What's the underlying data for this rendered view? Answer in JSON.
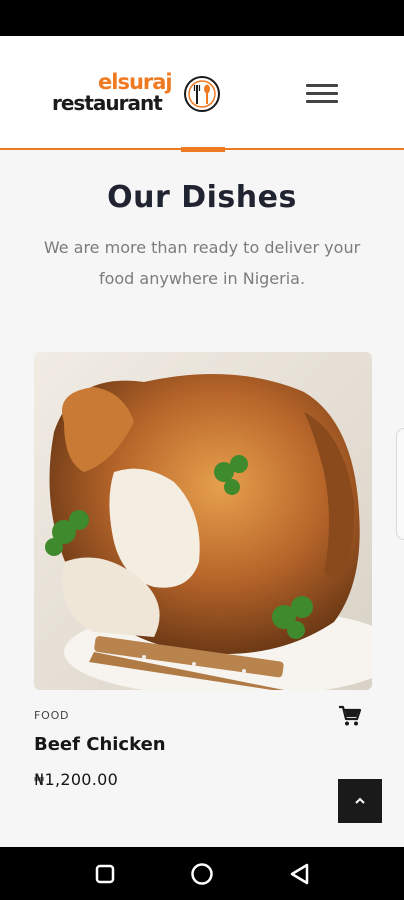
{
  "header": {
    "logo_top": "elsuraj",
    "logo_bottom": "restaurant",
    "accent_color": "#f07a22",
    "menu_icon": "hamburger-menu-icon"
  },
  "section": {
    "title": "Our Dishes",
    "subtitle_line1": "We are more than ready to deliver your",
    "subtitle_line2": "food anywhere in Nigeria."
  },
  "dish": {
    "category": "FOOD",
    "name": "Beef Chicken",
    "price": "₦1,200.00",
    "image": "roast-chicken-photo",
    "cart_icon": "shopping-cart-icon"
  },
  "controls": {
    "scroll_top_icon": "chevron-up-icon"
  },
  "system_nav": {
    "recents_icon": "square-icon",
    "home_icon": "circle-icon",
    "back_icon": "triangle-back-icon"
  }
}
